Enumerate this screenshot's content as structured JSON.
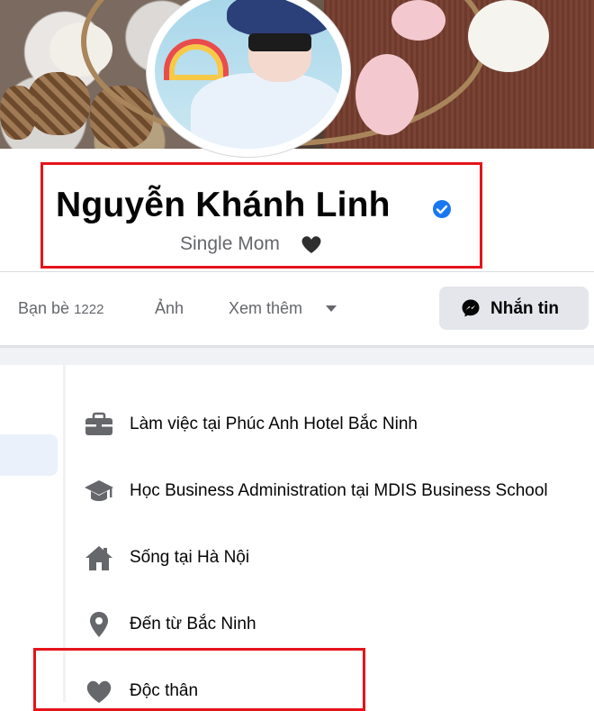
{
  "profile": {
    "name": "Nguyễn Khánh Linh",
    "bio": "Single Mom"
  },
  "tabs": [
    {
      "label": "Bạn bè",
      "count": "1222"
    },
    {
      "label": "Ảnh"
    },
    {
      "label": "Xem thêm"
    }
  ],
  "actions": {
    "message_label": "Nhắn tin"
  },
  "intro": [
    {
      "icon": "briefcase-icon",
      "text": "Làm việc tại Phúc Anh Hotel Bắc Ninh"
    },
    {
      "icon": "graduation-cap-icon",
      "text": "Học Business Administration tại MDIS Business School"
    },
    {
      "icon": "home-icon",
      "text": "Sống tại Hà Nội"
    },
    {
      "icon": "location-pin-icon",
      "text": "Đến từ Bắc Ninh"
    },
    {
      "icon": "heart-icon",
      "text": "Độc thân"
    }
  ],
  "colors": {
    "highlight_box": "#e4141b",
    "verified_blue": "#1877f2",
    "icon_gray": "#65676b"
  }
}
